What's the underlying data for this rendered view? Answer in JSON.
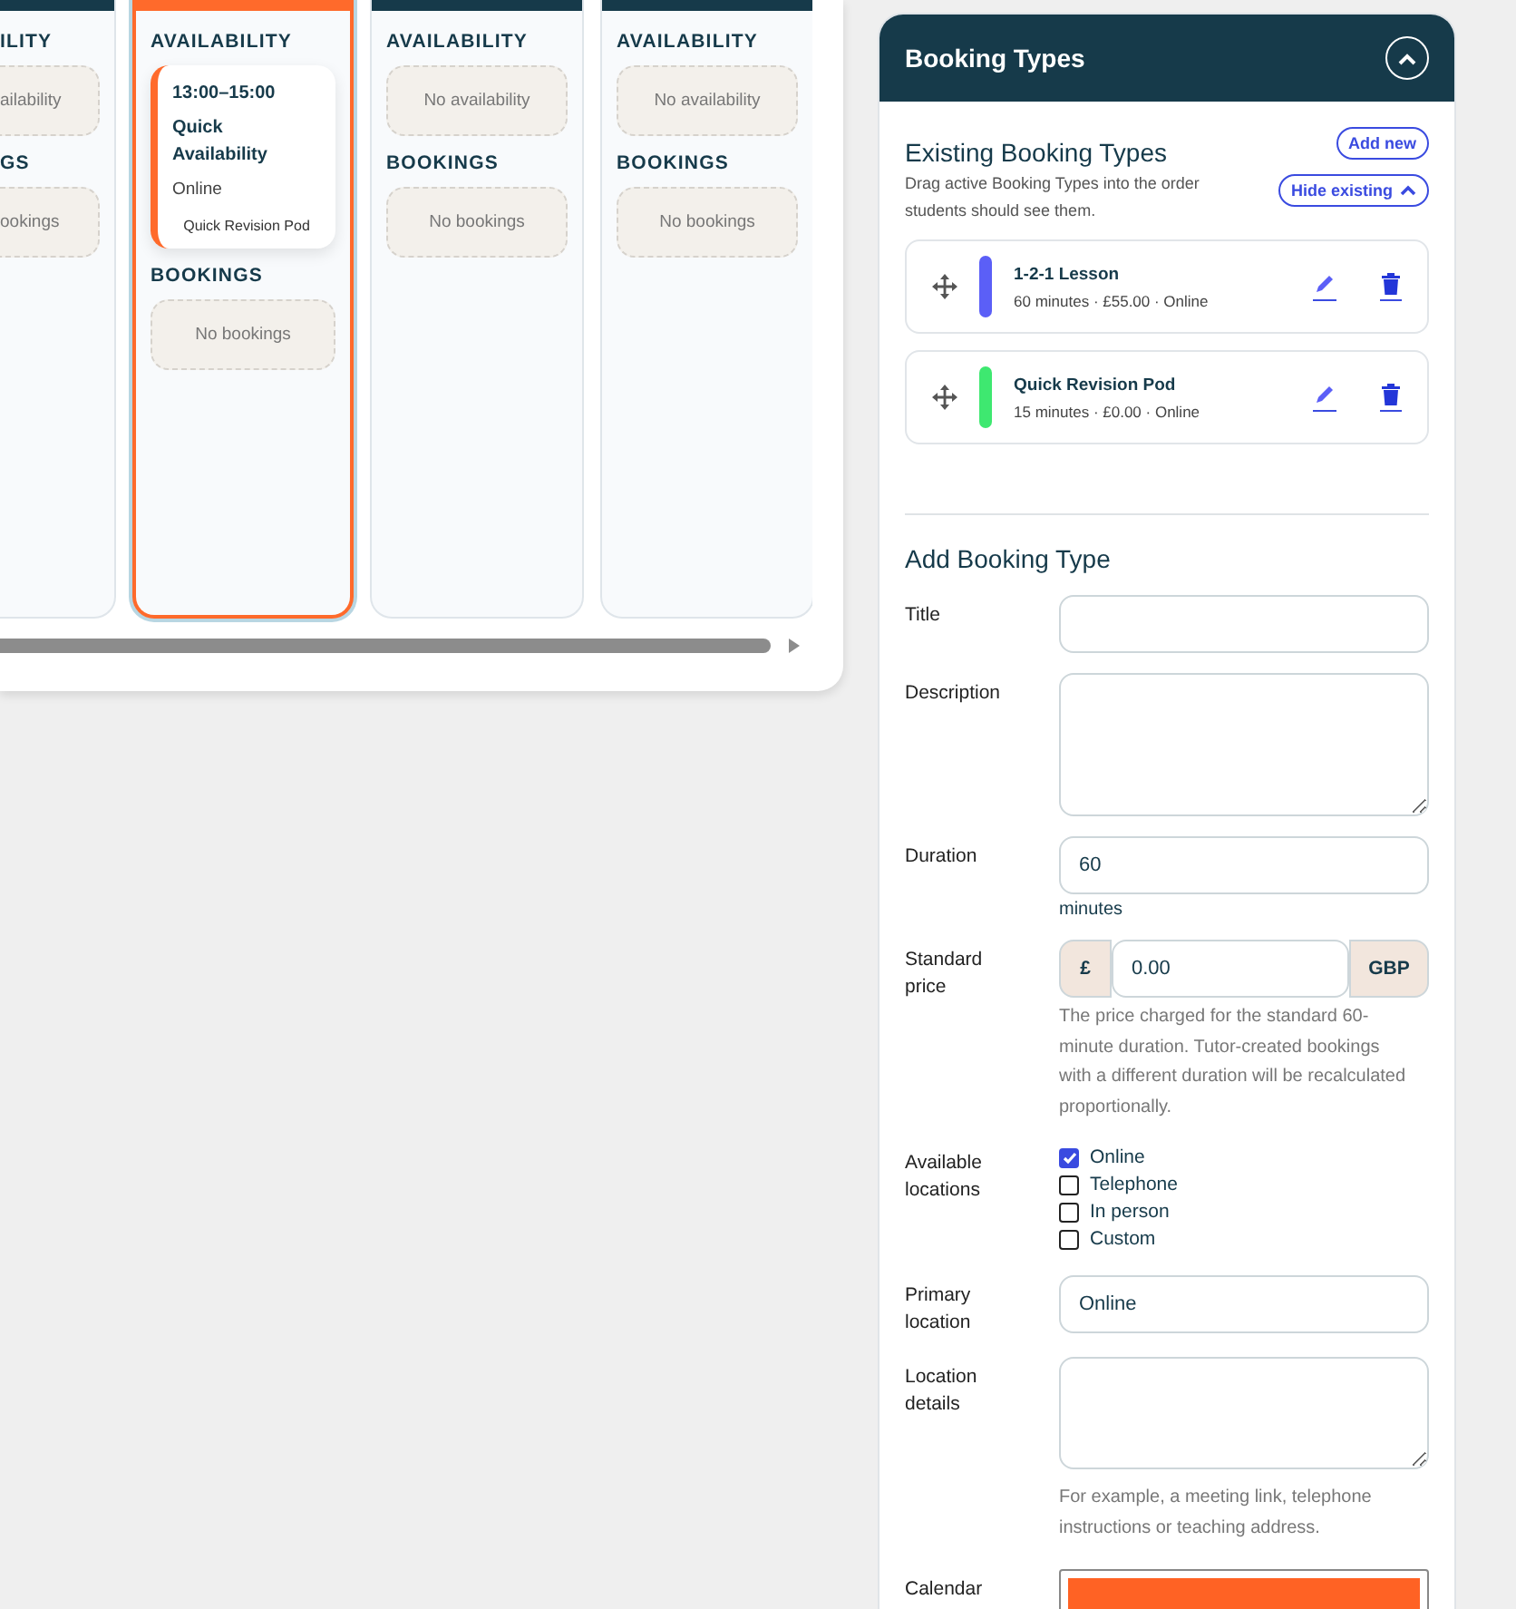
{
  "calendar": {
    "days": [
      {
        "selected": false,
        "availability_heading": "ILITY",
        "availability_empty": "ailability",
        "bookings_heading": "GS",
        "bookings_empty": "ookings",
        "partial": true
      },
      {
        "selected": true,
        "availability_heading": "AVAILABILITY",
        "availability": [
          {
            "time": "13:00–15:00",
            "title": "Quick Availability",
            "location": "Online",
            "type": "Quick Revision Pod"
          }
        ],
        "bookings_heading": "BOOKINGS",
        "bookings_empty": "No bookings",
        "partial": false
      },
      {
        "selected": false,
        "availability_heading": "AVAILABILITY",
        "availability_empty": "No availability",
        "bookings_heading": "BOOKINGS",
        "bookings_empty": "No bookings",
        "partial": false
      },
      {
        "selected": false,
        "availability_heading": "AVAILABILITY",
        "availability_empty": "No availability",
        "bookings_heading": "BOOKINGS",
        "bookings_empty": "No bookings",
        "partial": false
      }
    ]
  },
  "panel": {
    "title": "Booking Types",
    "existing": {
      "heading": "Existing Booking Types",
      "description": "Drag active Booking Types into the order students should see them.",
      "add_button": "Add new",
      "hide_button": "Hide existing",
      "types": [
        {
          "name": "1-2-1 Lesson",
          "meta": "60 minutes · £55.00 · Online",
          "color": "#5b5ff7"
        },
        {
          "name": "Quick Revision Pod",
          "meta": "15 minutes · £0.00 · Online",
          "color": "#3ee870"
        }
      ]
    },
    "form": {
      "heading": "Add Booking Type",
      "title": {
        "label": "Title"
      },
      "description": {
        "label": "Description"
      },
      "duration": {
        "label": "Duration",
        "value": "60",
        "suffix": "minutes"
      },
      "price": {
        "label": "Standard price",
        "prefix": "£",
        "value": "0.00",
        "currency": "GBP",
        "help": "The price charged for the standard 60-minute duration. Tutor-created bookings with a different duration will be recalculated proportionally."
      },
      "locations": {
        "label": "Available locations",
        "options": [
          {
            "label": "Online",
            "checked": true
          },
          {
            "label": "Telephone",
            "checked": false
          },
          {
            "label": "In person",
            "checked": false
          },
          {
            "label": "Custom",
            "checked": false
          }
        ]
      },
      "primary_location": {
        "label": "Primary location",
        "value": "Online"
      },
      "location_details": {
        "label": "Location details",
        "help": "For example, a meeting link, telephone instructions or teaching address."
      },
      "calendar_colour": {
        "label": "Calendar",
        "color": "#ff6224"
      }
    }
  }
}
